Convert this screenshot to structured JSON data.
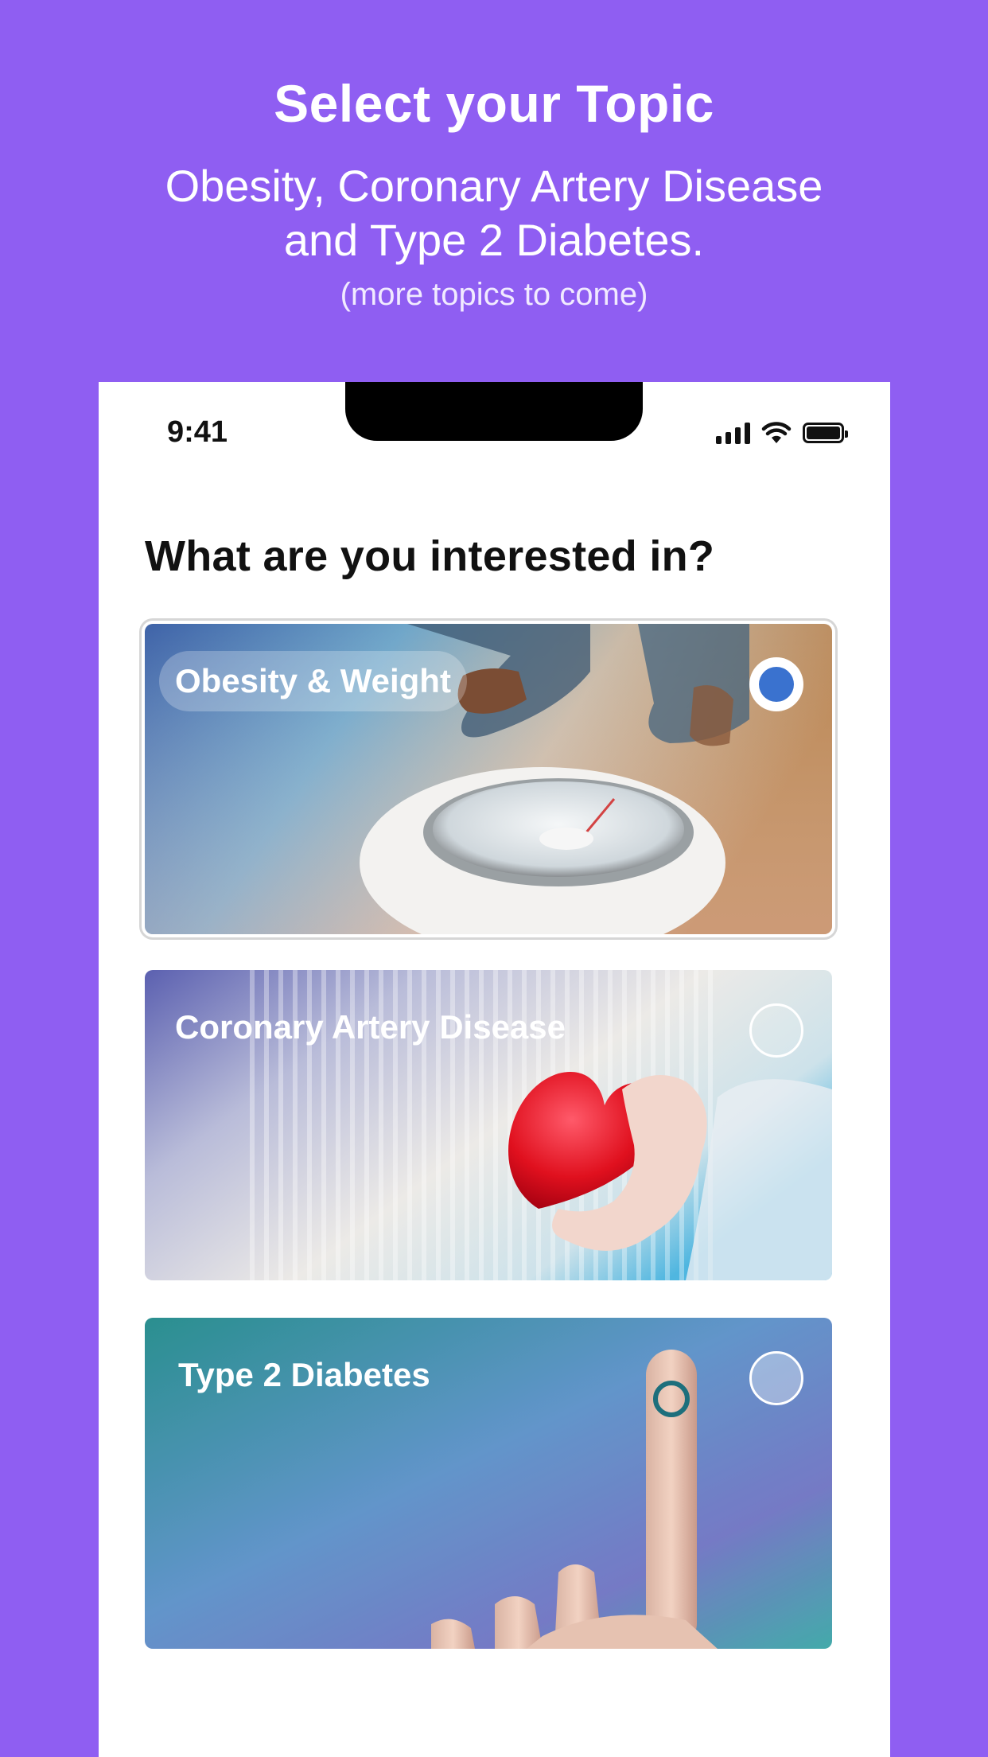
{
  "hero": {
    "title": "Select your Topic",
    "subtitle_line1": "Obesity, Coronary Artery Disease",
    "subtitle_line2": "and Type 2 Diabetes.",
    "note": "(more topics to come)"
  },
  "status_bar": {
    "time": "9:41",
    "icons": [
      "cellular-signal-icon",
      "wifi-icon",
      "battery-icon"
    ]
  },
  "screen": {
    "question": "What are you interested in?",
    "topics": [
      {
        "label": "Obesity & Weight",
        "selected": true,
        "image": "feet-on-bathroom-scale"
      },
      {
        "label": "Coronary Artery Disease",
        "selected": false,
        "image": "hand-holding-red-heart"
      },
      {
        "label": "Type 2 Diabetes",
        "selected": false,
        "image": "finger-blood-glucose-test"
      }
    ]
  },
  "colors": {
    "background": "#8f5ef2",
    "radio_selected": "#3a72cf",
    "card_1_tone": "#5a8fc0",
    "card_2_tone": "#6f7fc4",
    "card_3_tone": "#2f9aa5"
  }
}
